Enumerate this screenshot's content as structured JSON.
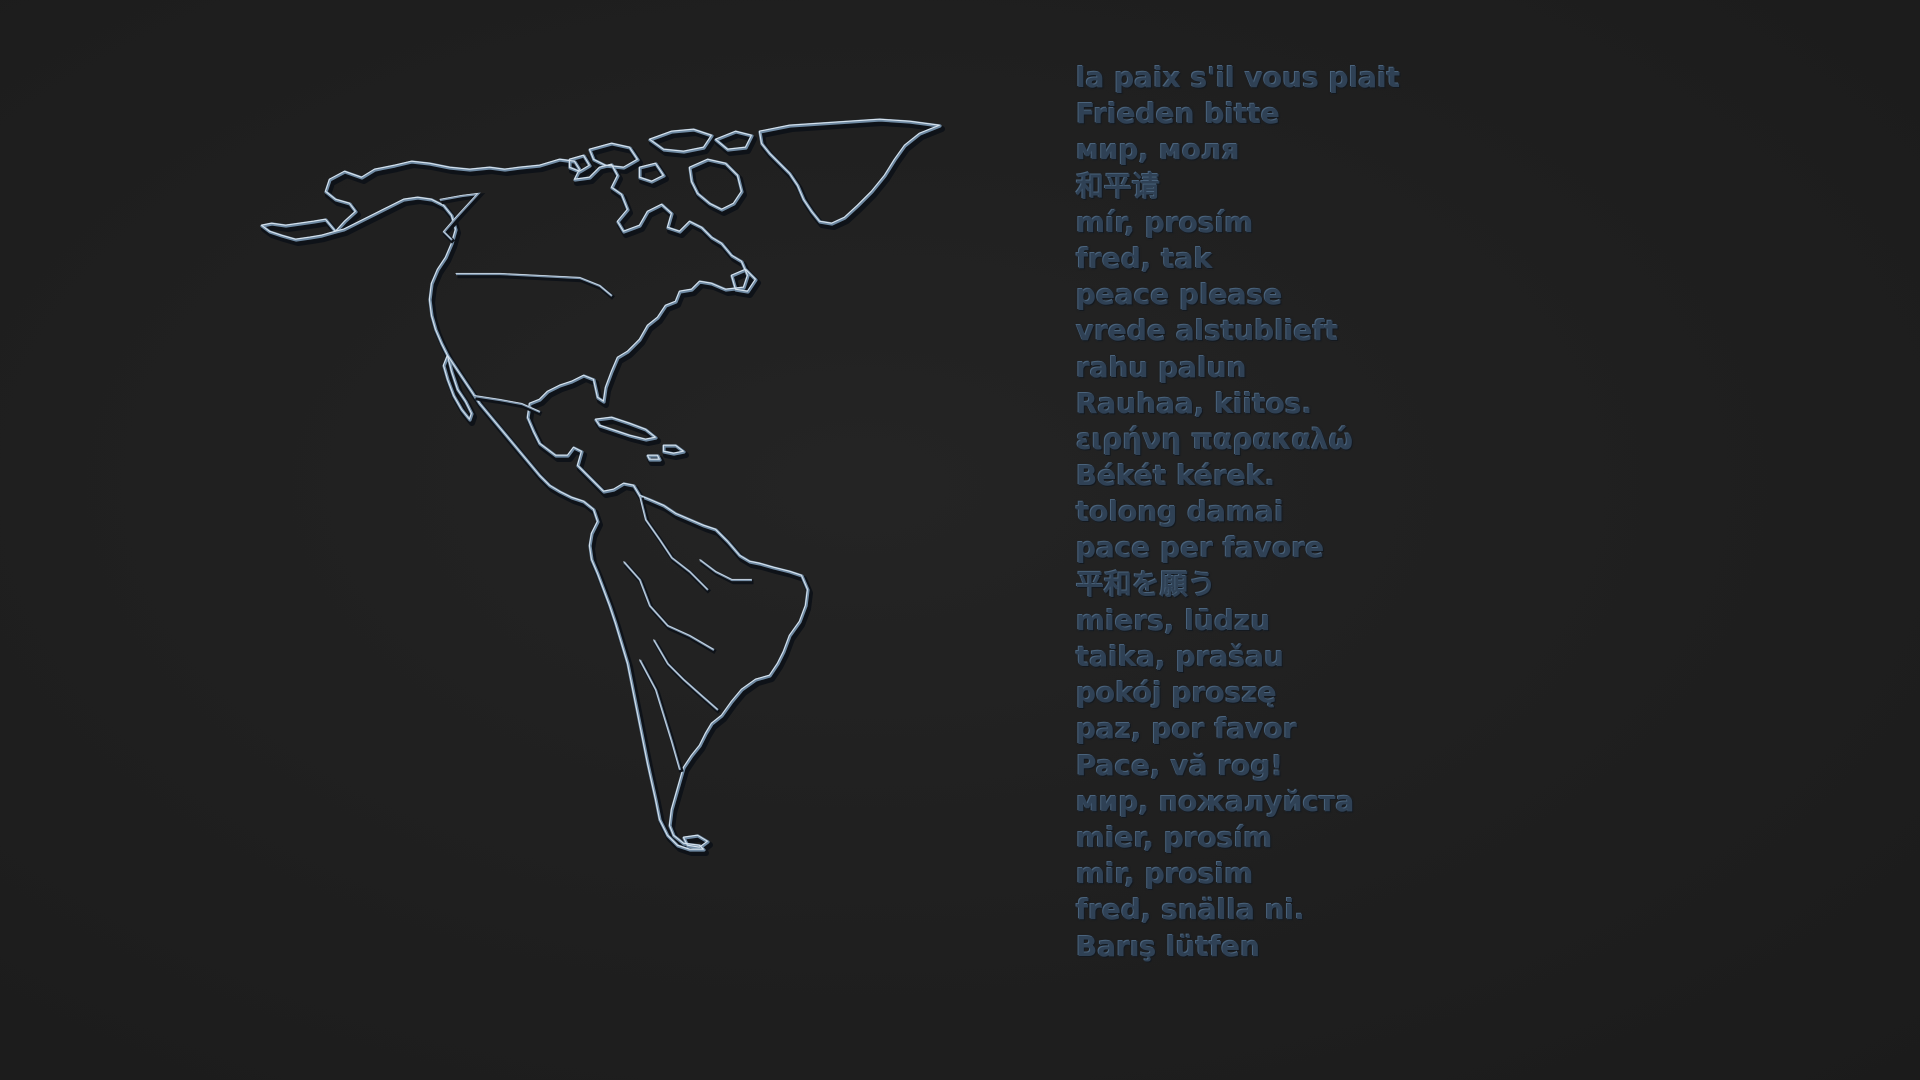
{
  "wallpaper": {
    "background_color": "#1f1f1f",
    "outline_color": "#6f8aa3",
    "text_color": "#2f4155",
    "subject": "americas-outline-map"
  },
  "phrases": [
    "la paix s'il vous plait",
    "Frieden bitte",
    "мир, моля",
    "和平请",
    "mír, prosím",
    "fred, tak",
    "peace please",
    "vrede alstublieft",
    "rahu palun",
    "Rauhaa, kiitos.",
    "ειρήνη παρακαλώ",
    "Békét kérek.",
    "tolong damai",
    "pace per favore",
    "平和を願う",
    "miers, lūdzu",
    "taika, prašau",
    "pokój proszę",
    "paz, por favor",
    "Pace, vă rog!",
    "мир, пожалуйста",
    "mier, prosím",
    "mir, prosim",
    "fred, snälla ni.",
    "Barış lütfen"
  ]
}
